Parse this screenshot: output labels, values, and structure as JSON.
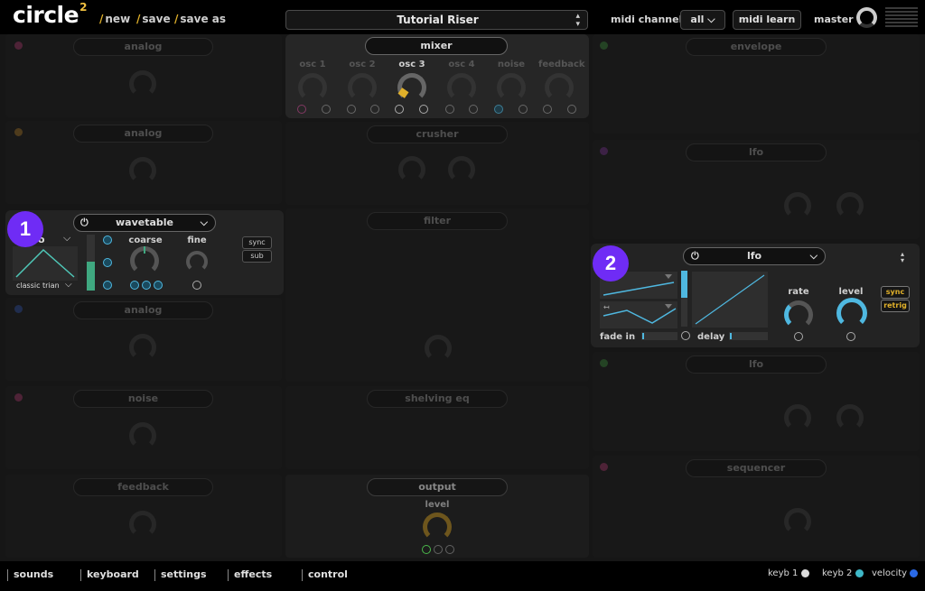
{
  "app": {
    "logo": "circle",
    "logo_sup": "2",
    "links": [
      {
        "label": "new"
      },
      {
        "label": "save"
      },
      {
        "label": "save as"
      }
    ],
    "slash": "/"
  },
  "preset": {
    "name": "Tutorial Riser"
  },
  "midi": {
    "label": "midi channel",
    "channel": "all",
    "learn": "midi learn"
  },
  "master": {
    "label": "master"
  },
  "mixer": {
    "title": "mixer",
    "channels": [
      "osc 1",
      "osc 2",
      "osc 3",
      "osc 4",
      "noise",
      "feedback"
    ]
  },
  "left_slots": [
    {
      "title": "analog",
      "color": "#e0468c"
    },
    {
      "title": "analog",
      "color": "#e09a2c"
    },
    {
      "title": "wavetable",
      "color": "#4fb8e0"
    },
    {
      "title": "analog",
      "color": "#3a6ae0"
    },
    {
      "title": "noise",
      "color": "#e0468c"
    },
    {
      "title": "feedback",
      "color": "#888888"
    }
  ],
  "wavetable": {
    "title": "wavetable",
    "wave_name": "classic trian",
    "coarse": "coarse",
    "fine": "fine",
    "sync": "sync",
    "sub": "sub",
    "fragment": "o"
  },
  "middle_slots": [
    {
      "title": "crusher"
    },
    {
      "title": "filter"
    },
    {
      "title": "shelving eq"
    },
    {
      "title": "output",
      "knob_label": "level"
    }
  ],
  "right_slots": [
    {
      "title": "envelope",
      "color": "#4ab84a"
    },
    {
      "title": "lfo",
      "color": "#a040c0"
    },
    {
      "title": "lfo",
      "color": "#4ab84a"
    },
    {
      "title": "sequencer",
      "color": "#e0468c"
    }
  ],
  "lfo": {
    "title": "lfo",
    "fade_in": "fade in",
    "delay": "delay",
    "rate": "rate",
    "level": "level",
    "sync": "sync",
    "retrig": "retrig"
  },
  "badges": [
    "1",
    "2"
  ],
  "bottom": {
    "tabs": [
      "sounds",
      "keyboard",
      "settings",
      "effects",
      "control"
    ],
    "keyb1": "keyb 1",
    "keyb2": "keyb 2",
    "velocity": "velocity"
  },
  "colors": {
    "accent_blue": "#4fb8e0",
    "accent_yellow": "#e0b02a",
    "badge": "#6f2cf5",
    "keyb1": "#dddddd",
    "keyb2": "#3fb8c8",
    "velocity": "#2a6ae8"
  }
}
